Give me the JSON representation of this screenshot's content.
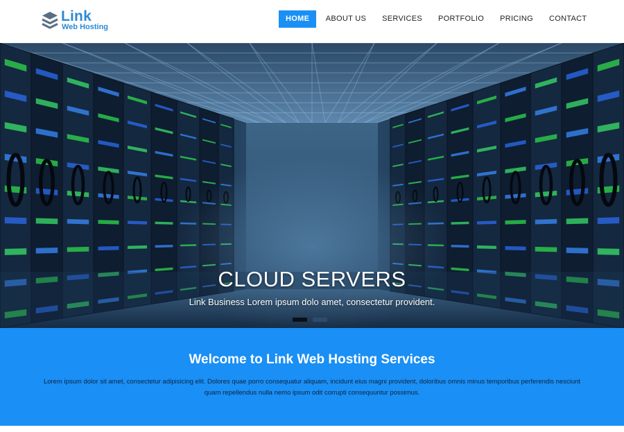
{
  "brand": {
    "name": "Link",
    "tagline": "Web Hosting",
    "color": "#2c8ad3"
  },
  "nav": {
    "items": [
      {
        "label": "HOME",
        "active": true
      },
      {
        "label": "ABOUT US",
        "active": false
      },
      {
        "label": "SERVICES",
        "active": false
      },
      {
        "label": "PORTFOLIO",
        "active": false
      },
      {
        "label": "PRICING",
        "active": false
      },
      {
        "label": "CONTACT",
        "active": false
      }
    ]
  },
  "hero": {
    "title": "CLOUD SERVERS",
    "subtitle": "Link Business Lorem ipsum dolo amet, consectetur provident.",
    "image": "server-room-corridor"
  },
  "carousel": {
    "active_slide": 1,
    "slide_count": 2
  },
  "welcome": {
    "title": "Welcome to Link Web Hosting Services",
    "text": "Lorem ipsum dolor sit amet, consectetur adipisicing elit. Dolores quae porro consequatur aliquam, incidunt eius magni provident, doloribus omnis minus temporibus perferendis nesciunt quam repellendus nulla nemo ipsum odit corrupti consequuntur possimus."
  },
  "colors": {
    "accent": "#1a8ff5",
    "header_bg": "#ffffff",
    "hero_tint": "#162b46"
  }
}
